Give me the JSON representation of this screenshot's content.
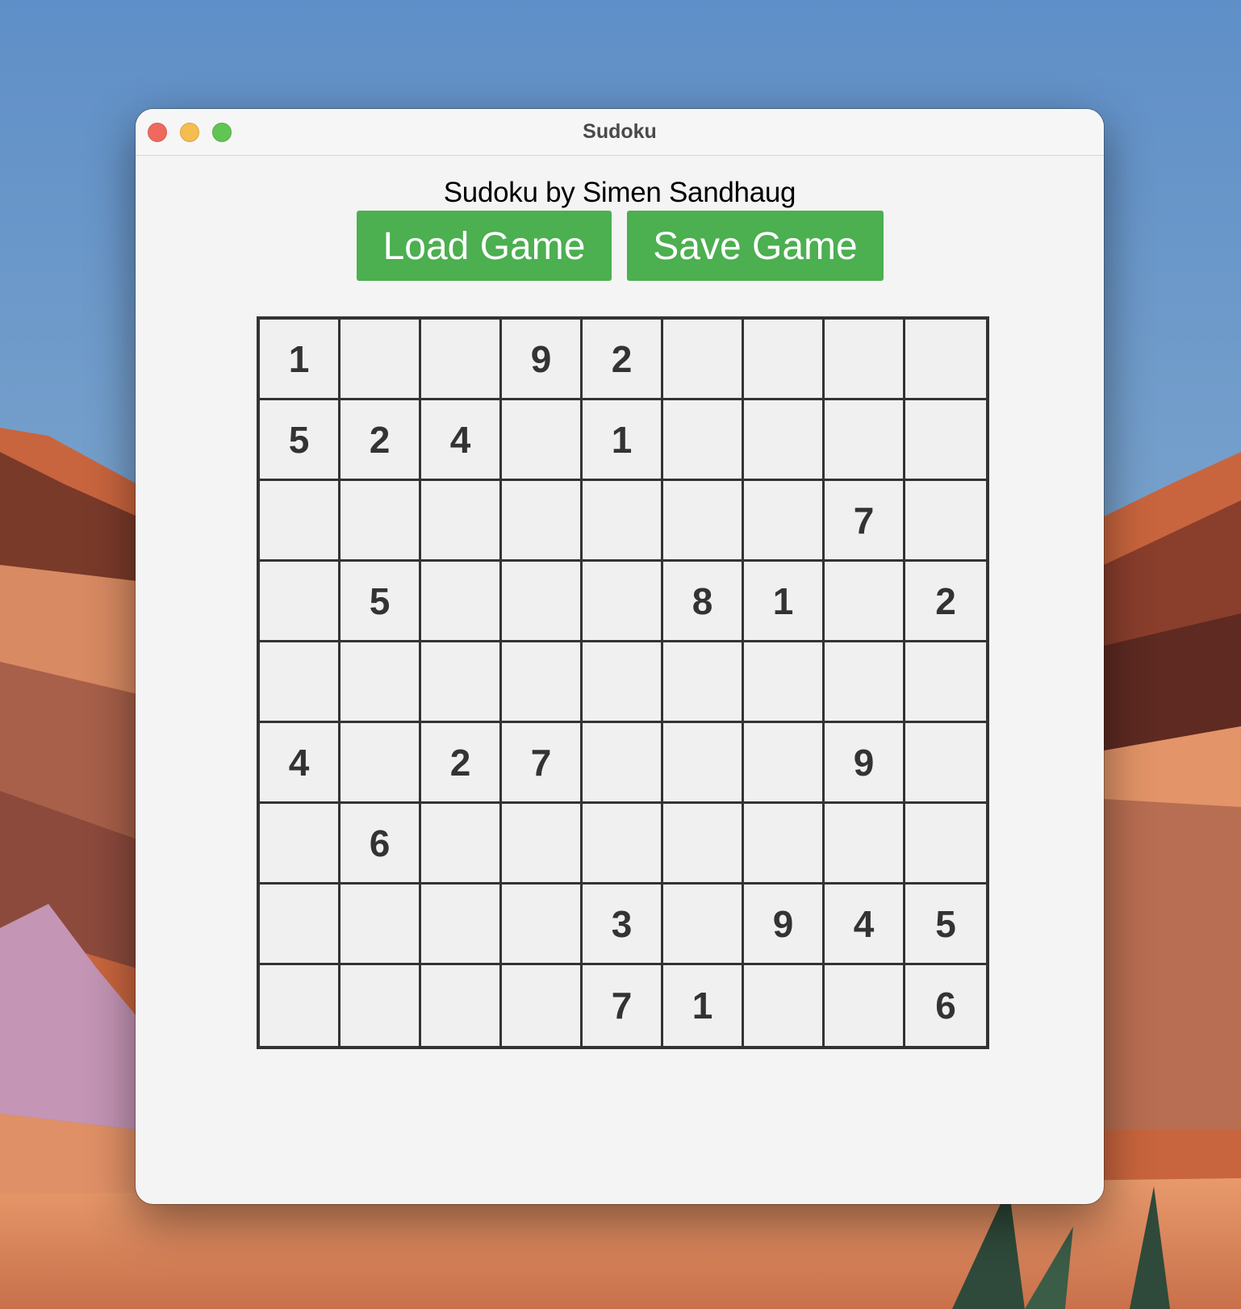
{
  "window": {
    "title": "Sudoku"
  },
  "app": {
    "heading": "Sudoku by Simen Sandhaug",
    "load_button": "Load Game",
    "save_button": "Save Game"
  },
  "board": {
    "rows": [
      [
        "1",
        "",
        "",
        "9",
        "2",
        "",
        "",
        "",
        ""
      ],
      [
        "5",
        "2",
        "4",
        "",
        "1",
        "",
        "",
        "",
        ""
      ],
      [
        "",
        "",
        "",
        "",
        "",
        "",
        "",
        "7",
        ""
      ],
      [
        "",
        "5",
        "",
        "",
        "",
        "8",
        "1",
        "",
        "2"
      ],
      [
        "",
        "",
        "",
        "",
        "",
        "",
        "",
        "",
        ""
      ],
      [
        "4",
        "",
        "2",
        "7",
        "",
        "",
        "",
        "9",
        ""
      ],
      [
        "",
        "6",
        "",
        "",
        "",
        "",
        "",
        "",
        ""
      ],
      [
        "",
        "",
        "",
        "",
        "3",
        "",
        "9",
        "4",
        "5"
      ],
      [
        "",
        "",
        "",
        "",
        "7",
        "1",
        "",
        "",
        "6"
      ]
    ]
  },
  "colors": {
    "button_green": "#4caf50",
    "grid_line": "#333333",
    "cell_background": "#f0f0f0"
  }
}
